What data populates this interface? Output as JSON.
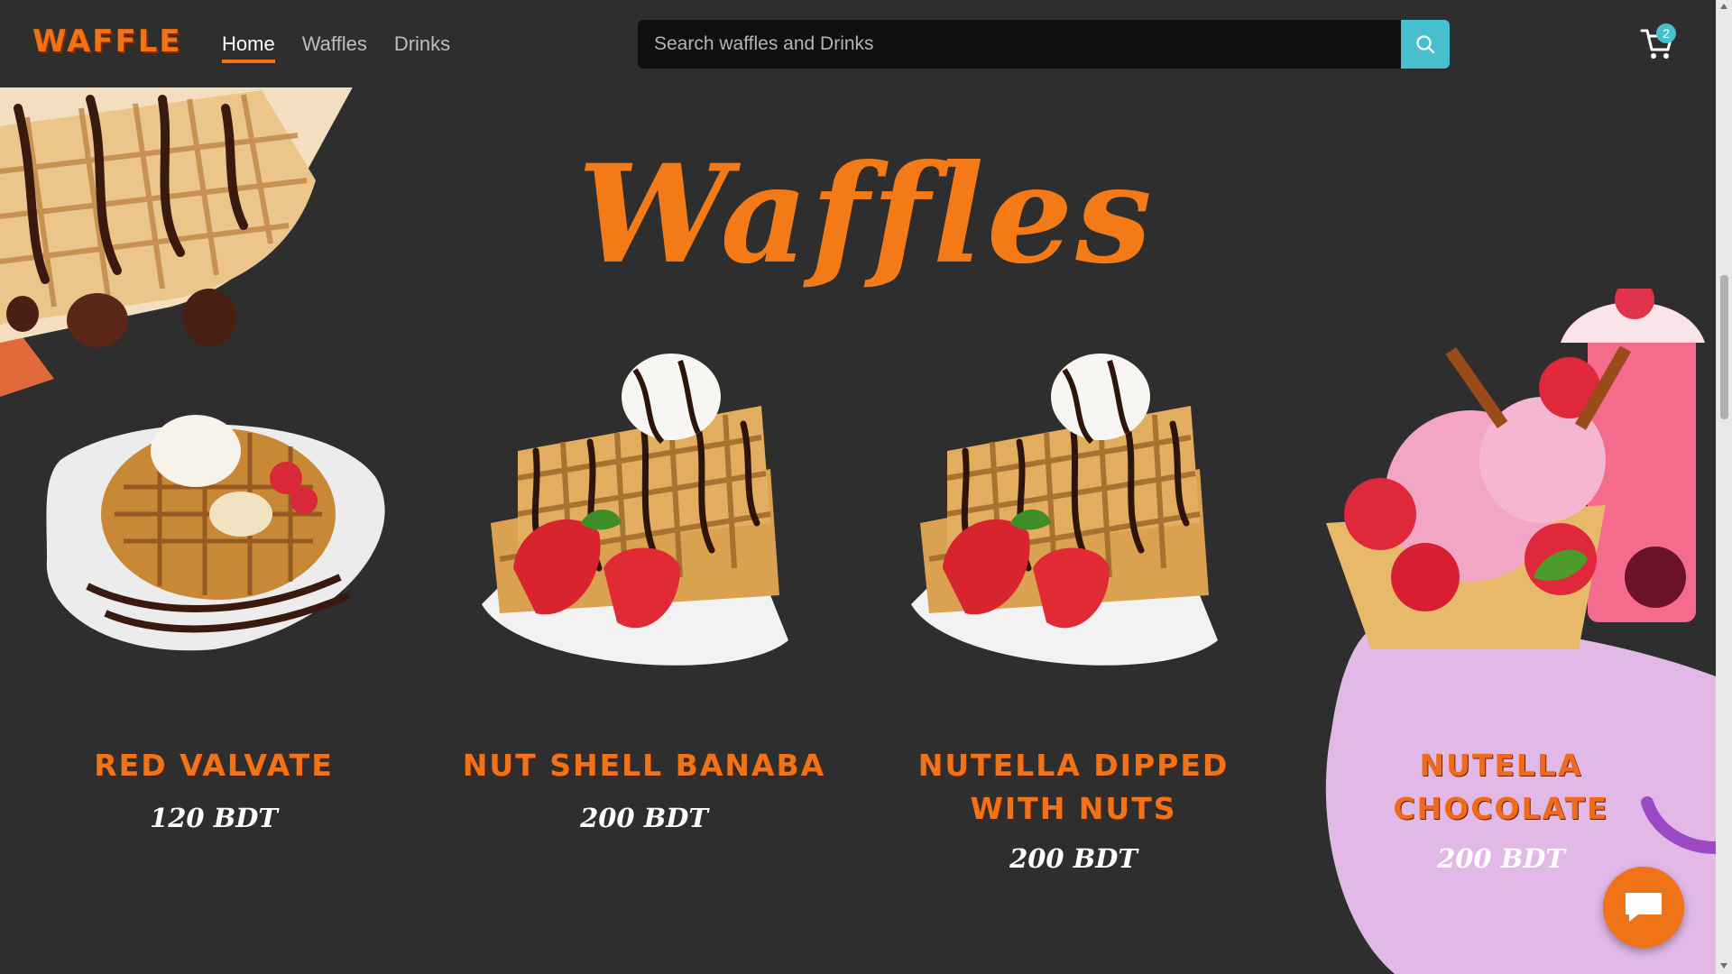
{
  "brand": {
    "logo_text": "WAFFLE"
  },
  "nav": {
    "links": [
      {
        "label": "Home",
        "active": true
      },
      {
        "label": "Waffles",
        "active": false
      },
      {
        "label": "Drinks",
        "active": false
      }
    ]
  },
  "search": {
    "placeholder": "Search waffles and Drinks",
    "value": ""
  },
  "cart": {
    "count": "2"
  },
  "section": {
    "title": "Waffles"
  },
  "products": [
    {
      "name": "Red Valvate",
      "price": "120 BDT",
      "image": "waffle-plate-image"
    },
    {
      "name": "Nut Shell Banaba",
      "price": "200 BDT",
      "image": "waffle-strawberry-image"
    },
    {
      "name": "Nutella Dipped with Nuts",
      "price": "200 BDT",
      "image": "waffle-strawberry-image"
    },
    {
      "name": "Nutella Chocolate",
      "price": "200 BDT",
      "image": "strawberry-icecream-image"
    }
  ],
  "colors": {
    "accent": "#f07417",
    "background": "#2f2e2e",
    "search_button": "#48bfcf",
    "pink_blob": "#e2b9e6"
  },
  "icons": {
    "search": "search-icon",
    "cart": "cart-icon",
    "chat": "chat-icon"
  }
}
